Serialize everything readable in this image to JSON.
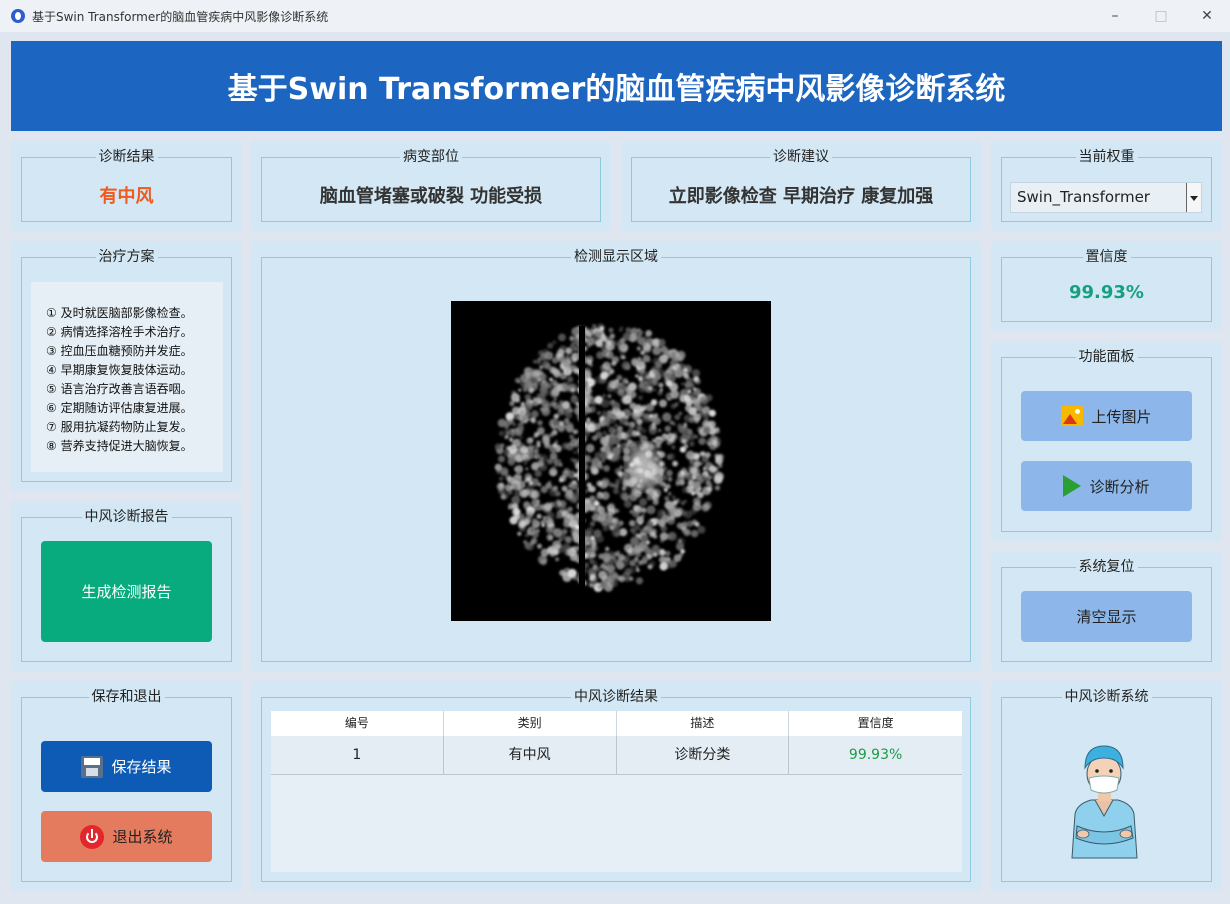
{
  "window": {
    "title": "基于Swin Transformer的脑血管疾病中风影像诊断系统"
  },
  "header": {
    "title": "基于Swin Transformer的脑血管疾病中风影像诊断系统"
  },
  "diagnosis": {
    "label": "诊断结果",
    "value": "有中风",
    "value_color": "#ef5a1f"
  },
  "lesion": {
    "label": "病变部位",
    "value": "脑血管堵塞或破裂 功能受损"
  },
  "advice": {
    "label": "诊断建议",
    "value": "立即影像检查 早期治疗 康复加强"
  },
  "weights": {
    "label": "当前权重",
    "selected": "Swin_Transformer"
  },
  "treatment": {
    "label": "治疗方案",
    "items": [
      "① 及时就医脑部影像检查。",
      "② 病情选择溶栓手术治疗。",
      "③ 控血压血糖预防并发症。",
      "④ 早期康复恢复肢体运动。",
      "⑤ 语言治疗改善言语吞咽。",
      "⑥ 定期随访评估康复进展。",
      "⑦ 服用抗凝药物防止复发。",
      "⑧ 营养支持促进大脑恢复。"
    ]
  },
  "detection": {
    "label": "检测显示区域"
  },
  "confidence": {
    "label": "置信度",
    "value": "99.93%",
    "value_color": "#15a07f"
  },
  "functions": {
    "label": "功能面板",
    "upload": "上传图片",
    "analyze": "诊断分析"
  },
  "reset": {
    "label": "系统复位",
    "clear": "清空显示"
  },
  "report": {
    "label": "中风诊断报告",
    "generate": "生成检测报告"
  },
  "save_exit": {
    "label": "保存和退出",
    "save": "保存结果",
    "exit": "退出系统"
  },
  "results": {
    "label": "中风诊断结果",
    "columns": [
      "编号",
      "类别",
      "描述",
      "置信度"
    ],
    "rows": [
      {
        "id": "1",
        "category": "有中风",
        "desc": "诊断分类",
        "conf": "99.93%"
      }
    ]
  },
  "mascot": {
    "label": "中风诊断系统"
  },
  "colors": {
    "banner": "#1c65c0",
    "panel": "#d3e8f4",
    "accent_green": "#07ab7e",
    "accent_navy": "#0d5bb5",
    "accent_salmon": "#e57b5e"
  },
  "icons": {
    "upload": "image-icon",
    "analyze": "play-icon",
    "save": "floppy-disk-icon",
    "exit": "power-icon"
  }
}
